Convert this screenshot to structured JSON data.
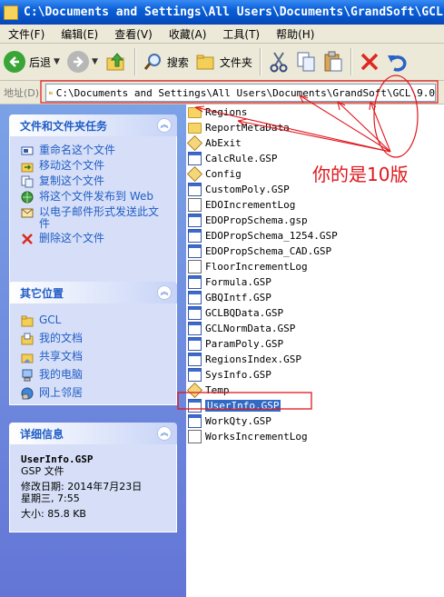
{
  "window": {
    "title": "C:\\Documents and Settings\\All Users\\Documents\\GrandSoft\\GCL"
  },
  "menu": [
    {
      "label": "文件(F)"
    },
    {
      "label": "编辑(E)"
    },
    {
      "label": "查看(V)"
    },
    {
      "label": "收藏(A)"
    },
    {
      "label": "工具(T)"
    },
    {
      "label": "帮助(H)"
    }
  ],
  "toolbar": {
    "back_label": "后退",
    "search_label": "搜索",
    "folders_label": "文件夹",
    "icons": [
      "back-arrow-icon",
      "forward-arrow-icon",
      "up-folder-icon",
      "search-icon",
      "folders-icon",
      "cut-icon",
      "copy-icon",
      "paste-icon",
      "delete-icon",
      "undo-icon"
    ]
  },
  "address": {
    "label": "地址(D)",
    "path": "C:\\Documents and Settings\\All Users\\Documents\\GrandSoft\\GCL\\9.0"
  },
  "tasks_panel": {
    "title": "文件和文件夹任务",
    "items": [
      {
        "label": "重命名这个文件",
        "icon": "rename-icon"
      },
      {
        "label": "移动这个文件",
        "icon": "move-icon"
      },
      {
        "label": "复制这个文件",
        "icon": "copy-file-icon"
      },
      {
        "label": "将这个文件发布到 Web",
        "icon": "publish-web-icon"
      },
      {
        "label": "以电子邮件形式发送此文件",
        "icon": "email-icon"
      },
      {
        "label": "删除这个文件",
        "icon": "delete-x-icon"
      }
    ]
  },
  "places_panel": {
    "title": "其它位置",
    "items": [
      {
        "label": "GCL",
        "icon": "folder-icon"
      },
      {
        "label": "我的文档",
        "icon": "my-documents-icon"
      },
      {
        "label": "共享文档",
        "icon": "shared-documents-icon"
      },
      {
        "label": "我的电脑",
        "icon": "my-computer-icon"
      },
      {
        "label": "网上邻居",
        "icon": "network-icon"
      }
    ]
  },
  "details_panel": {
    "title": "详细信息",
    "name": "UserInfo.GSP",
    "type": "GSP 文件",
    "modified_line1": "修改日期: 2014年7月23日",
    "modified_line2": "星期三, 7:55",
    "size": "大小: 85.8 KB"
  },
  "files": [
    {
      "name": "Regions",
      "kind": "folder"
    },
    {
      "name": "ReportMetaData",
      "kind": "folder"
    },
    {
      "name": "AbExit",
      "kind": "app"
    },
    {
      "name": "CalcRule.GSP",
      "kind": "gsp"
    },
    {
      "name": "Config",
      "kind": "app"
    },
    {
      "name": "CustomPoly.GSP",
      "kind": "gsp"
    },
    {
      "name": "EDOIncrementLog",
      "kind": "file"
    },
    {
      "name": "EDOPropSchema.gsp",
      "kind": "gsp"
    },
    {
      "name": "EDOPropSchema_1254.GSP",
      "kind": "gsp"
    },
    {
      "name": "EDOPropSchema_CAD.GSP",
      "kind": "gsp"
    },
    {
      "name": "FloorIncrementLog",
      "kind": "file"
    },
    {
      "name": "Formula.GSP",
      "kind": "gsp"
    },
    {
      "name": "GBQIntf.GSP",
      "kind": "gsp"
    },
    {
      "name": "GCLBQData.GSP",
      "kind": "gsp"
    },
    {
      "name": "GCLNormData.GSP",
      "kind": "gsp"
    },
    {
      "name": "ParamPoly.GSP",
      "kind": "gsp"
    },
    {
      "name": "RegionsIndex.GSP",
      "kind": "gsp"
    },
    {
      "name": "SysInfo.GSP",
      "kind": "gsp"
    },
    {
      "name": "Temp",
      "kind": "app"
    },
    {
      "name": "UserInfo.GSP",
      "kind": "gsp",
      "selected": true
    },
    {
      "name": "WorkQty.GSP",
      "kind": "gsp"
    },
    {
      "name": "WorksIncrementLog",
      "kind": "file"
    }
  ],
  "annotation": {
    "text": "你的是10版",
    "color": "#e0171d"
  }
}
